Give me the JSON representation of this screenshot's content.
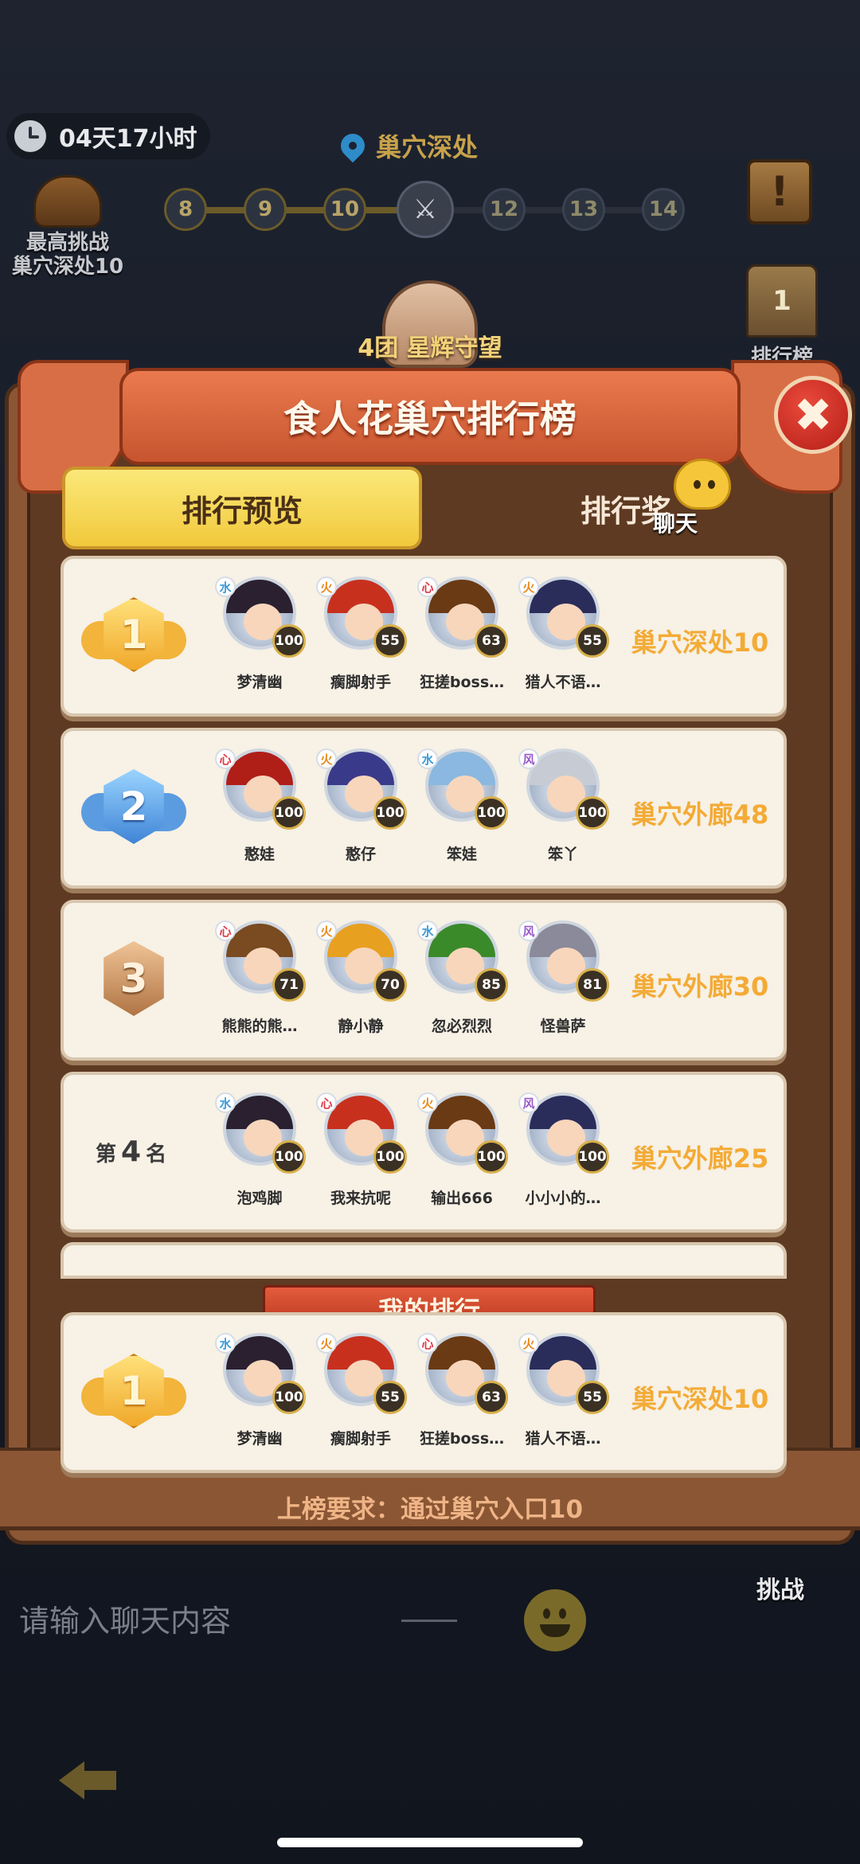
{
  "hud": {
    "timer": "04天17小时",
    "location": "巢穴深处",
    "best_line1": "最高挑战",
    "best_line2": "巢穴深处10",
    "nodes": [
      "8",
      "9",
      "10",
      "12",
      "13",
      "14"
    ],
    "notice_symbol": "!",
    "rank_side_number": "1",
    "rank_side_label": "排行榜"
  },
  "modal": {
    "team": "4团 星辉守望",
    "title": "食人花巢穴排行榜",
    "close_symbol": "✖",
    "tabs": [
      {
        "label": "排行预览",
        "active": true
      },
      {
        "label": "排行奖",
        "active": false
      }
    ],
    "chat_label": "聊天",
    "my_rank_title": "我的排行",
    "requirement": "上榜要求：通过巢穴入口10"
  },
  "ranks": [
    {
      "medal": "1",
      "progress": "巢穴深处10",
      "members": [
        {
          "name": "梦清幽",
          "level": "100",
          "element": "水"
        },
        {
          "name": "瘸脚射手",
          "level": "55",
          "element": "火"
        },
        {
          "name": "狂搓boss…",
          "level": "63",
          "element": "心"
        },
        {
          "name": "猎人不语…",
          "level": "55",
          "element": "火"
        }
      ]
    },
    {
      "medal": "2",
      "progress": "巢穴外廊48",
      "members": [
        {
          "name": "憨娃",
          "level": "100",
          "element": "心"
        },
        {
          "name": "憨仔",
          "level": "100",
          "element": "火"
        },
        {
          "name": "笨娃",
          "level": "100",
          "element": "水"
        },
        {
          "name": "笨丫",
          "level": "100",
          "element": "风"
        }
      ]
    },
    {
      "medal": "3",
      "progress": "巢穴外廊30",
      "members": [
        {
          "name": "熊熊的熊…",
          "level": "71",
          "element": "心"
        },
        {
          "name": "静小静",
          "level": "70",
          "element": "火"
        },
        {
          "name": "忽必烈烈",
          "level": "85",
          "element": "水"
        },
        {
          "name": "怪兽萨",
          "level": "81",
          "element": "风"
        }
      ]
    },
    {
      "rank_prefix": "第",
      "rank_number": "4",
      "rank_suffix": "名",
      "progress": "巢穴外廊25",
      "members": [
        {
          "name": "泡鸡脚",
          "level": "100",
          "element": "水"
        },
        {
          "name": "我来抗呢",
          "level": "100",
          "element": "心"
        },
        {
          "name": "输出666",
          "level": "100",
          "element": "火"
        },
        {
          "name": "小小小的…",
          "level": "100",
          "element": "风"
        }
      ]
    }
  ],
  "my_rank": {
    "medal": "1",
    "progress": "巢穴深处10",
    "members": [
      {
        "name": "梦清幽",
        "level": "100",
        "element": "水"
      },
      {
        "name": "瘸脚射手",
        "level": "55",
        "element": "火"
      },
      {
        "name": "狂搓boss…",
        "level": "63",
        "element": "心"
      },
      {
        "name": "猎人不语…",
        "level": "55",
        "element": "火"
      }
    ]
  },
  "bottom": {
    "challenge_label": "挑战",
    "chat_placeholder": "请输入聊天内容"
  },
  "colors": {
    "progress_text": "#f3ab36",
    "gold_tab": "#f1c93c",
    "banner": "#d86e45",
    "close": "#c8251c"
  }
}
